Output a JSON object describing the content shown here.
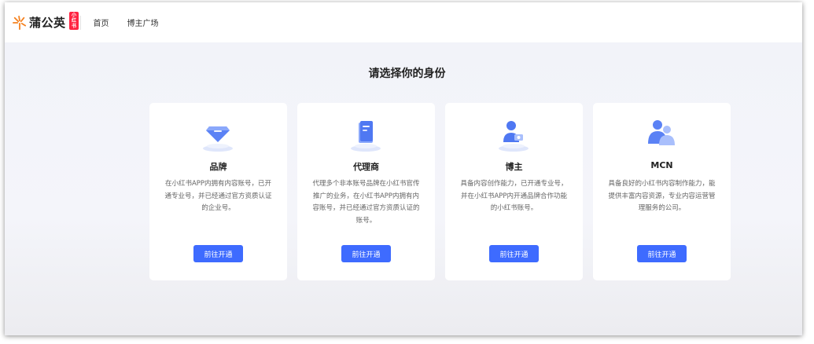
{
  "header": {
    "logo_text": "蒲公英",
    "logo_badge": "小红书",
    "nav": [
      "首页",
      "博主广场"
    ]
  },
  "page_title": "请选择你的身份",
  "cards": [
    {
      "icon": "diamond-icon",
      "title": "品牌",
      "desc": "在小红书APP内拥有内容账号，已开通专业号，并已经通过官方资质认证的企业号。",
      "button": "前往开通"
    },
    {
      "icon": "document-icon",
      "title": "代理商",
      "desc": "代理多个非本账号品牌在小红书官传推广的业务，在小红书APP内拥有内容账号，并已经通过官方资质认证的账号。",
      "button": "前往开通"
    },
    {
      "icon": "blogger-icon",
      "title": "博主",
      "desc": "具备内容创作能力，已开通专业号，并在小红书APP内开通品牌合作功能的小红书账号。",
      "button": "前往开通"
    },
    {
      "icon": "mcn-icon",
      "title": "MCN",
      "desc": "具备良好的小红书内容制作能力，能提供丰富内容资源，专业内容运营管理服务的公司。",
      "button": "前往开通"
    }
  ],
  "colors": {
    "accent": "#3e6bff",
    "badge": "#ff2442",
    "logo": "#f58220"
  }
}
